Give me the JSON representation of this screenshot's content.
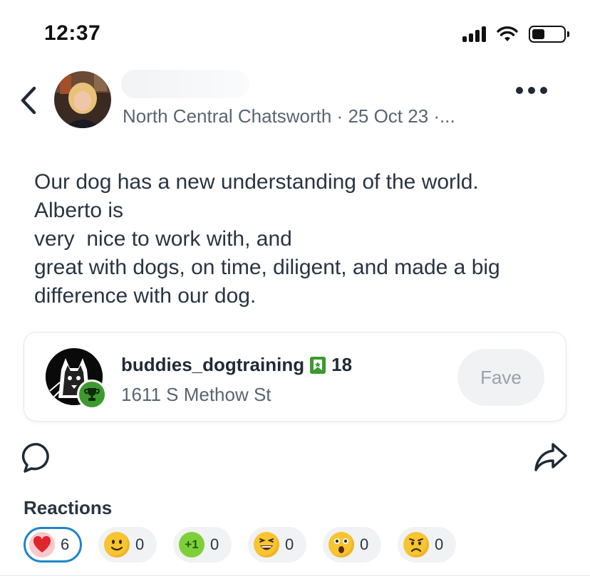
{
  "status_bar": {
    "time": "12:37",
    "battery_level": 0.4
  },
  "post": {
    "author_name": "",
    "meta": "North Central Chatsworth · 25 Oct 23 ·...",
    "body_lines": [
      "Our dog has a new understanding of the world.",
      "Alberto is",
      "very  nice to work with, and",
      "great with dogs, on time, diligent, and made a big",
      "difference with our dog."
    ]
  },
  "business": {
    "name": "buddies_dogtraining",
    "fave_count": "18",
    "address": "1611 S Methow St",
    "fave_button": "Fave"
  },
  "reactions": {
    "title": "Reactions",
    "items": [
      {
        "icon": "heart-icon",
        "count": "6",
        "active": true
      },
      {
        "icon": "smile-icon",
        "count": "0",
        "active": false
      },
      {
        "icon": "plus-one-icon",
        "label": "+1",
        "count": "0",
        "active": false
      },
      {
        "icon": "laughing-icon",
        "count": "0",
        "active": false
      },
      {
        "icon": "surprised-icon",
        "count": "0",
        "active": false
      },
      {
        "icon": "sad-icon",
        "count": "0",
        "active": false
      }
    ]
  },
  "colors": {
    "text": "#1f2a37",
    "muted": "#5b6472",
    "accent_green": "#3c9a2e",
    "active_outline": "#1f86c8"
  }
}
